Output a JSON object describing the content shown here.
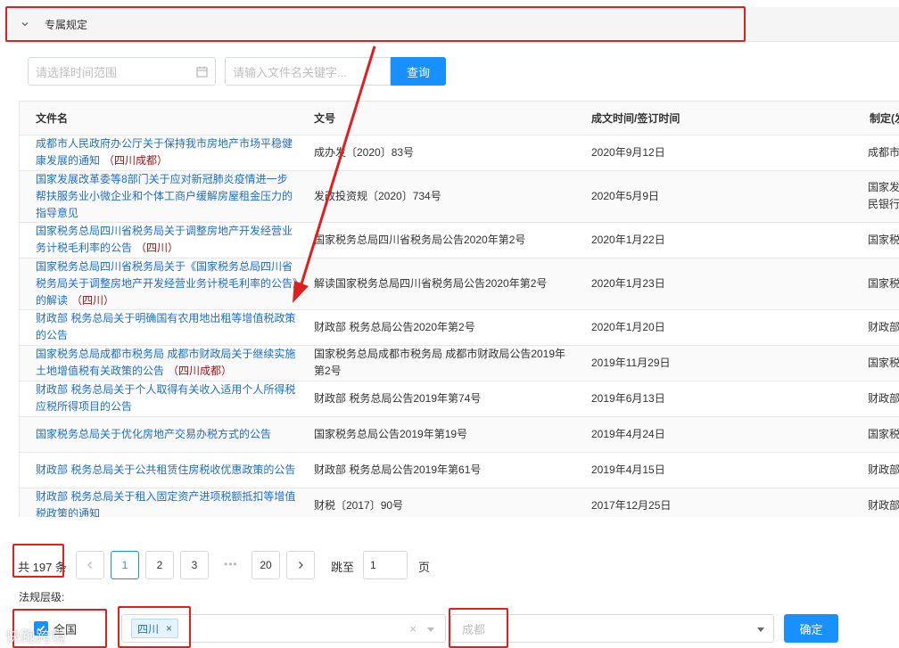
{
  "collapse": {
    "title": "专属规定"
  },
  "filters": {
    "date_placeholder": "请选择时间范围",
    "keyword_placeholder": "请输入文件名关键字...",
    "search_label": "查询"
  },
  "table": {
    "headers": [
      "文件名",
      "文号",
      "成文时间/签订时间",
      "制定(发"
    ],
    "rows": [
      {
        "name": "成都市人民政府办公厅关于保持我市房地产市场平稳健康发展的通知",
        "region": "（四川成都）",
        "doc_no": "成办发〔2020〕83号",
        "date": "2020年9月12日",
        "agency": "成都市"
      },
      {
        "name": "国家发展改革委等8部门关于应对新冠肺炎疫情进一步帮扶服务业小微企业和个体工商户缓解房屋租金压力的指导意见",
        "region": "",
        "doc_no": "发改投资规〔2020〕734号",
        "date": "2020年5月9日",
        "agency": "国家发\n民银行"
      },
      {
        "name": "国家税务总局四川省税务局关于调整房地产开发经营业务计税毛利率的公告",
        "region": "（四川）",
        "doc_no": "国家税务总局四川省税务局公告2020年第2号",
        "date": "2020年1月22日",
        "agency": "国家税"
      },
      {
        "name": "国家税务总局四川省税务局关于《国家税务总局四川省税务局关于调整房地产开发经营业务计税毛利率的公告》的解读",
        "region": "（四川）",
        "doc_no": "解读国家税务总局四川省税务局公告2020年第2号",
        "date": "2020年1月23日",
        "agency": "国家税"
      },
      {
        "name": "财政部 税务总局关于明确国有农用地出租等增值税政策的公告",
        "region": "",
        "doc_no": "财政部 税务总局公告2020年第2号",
        "date": "2020年1月20日",
        "agency": "财政部"
      },
      {
        "name": "国家税务总局成都市税务局 成都市财政局关于继续实施土地增值税有关政策的公告",
        "region": "（四川成都）",
        "doc_no": "国家税务总局成都市税务局 成都市财政局公告2019年第2号",
        "date": "2019年11月29日",
        "agency": "国家税"
      },
      {
        "name": "财政部 税务总局关于个人取得有关收入适用个人所得税应税所得项目的公告",
        "region": "",
        "doc_no": "财政部 税务总局公告2019年第74号",
        "date": "2019年6月13日",
        "agency": "财政部"
      },
      {
        "name": "国家税务总局关于优化房地产交易办税方式的公告",
        "region": "",
        "doc_no": "国家税务总局公告2019年第19号",
        "date": "2019年4月24日",
        "agency": "国家税"
      },
      {
        "name": "财政部 税务总局关于公共租赁住房税收优惠政策的公告",
        "region": "",
        "doc_no": "财政部 税务总局公告2019年第61号",
        "date": "2019年4月15日",
        "agency": "财政部"
      },
      {
        "name": "财政部 税务总局关于租入固定资产进项税额抵扣等增值税政策的通知",
        "region": "",
        "doc_no": "财税〔2017〕90号",
        "date": "2017年12月25日",
        "agency": "财政部"
      }
    ]
  },
  "pagination": {
    "total": "共 197 条",
    "pages": [
      "1",
      "2",
      "3",
      "20"
    ],
    "ellipsis": "•••",
    "jump_label": "跳至",
    "jump_value": "1",
    "page_suffix": "页"
  },
  "level": {
    "label": "法规层级:",
    "all_label": "全国",
    "province_tag": "四川",
    "city_placeholder": "成都",
    "confirm_label": "确定"
  },
  "watermark": "快跑跨境",
  "colors": {
    "primary": "#1890ff",
    "link": "#1c6fc6",
    "region": "#a01414",
    "annotation": "#e02020"
  }
}
